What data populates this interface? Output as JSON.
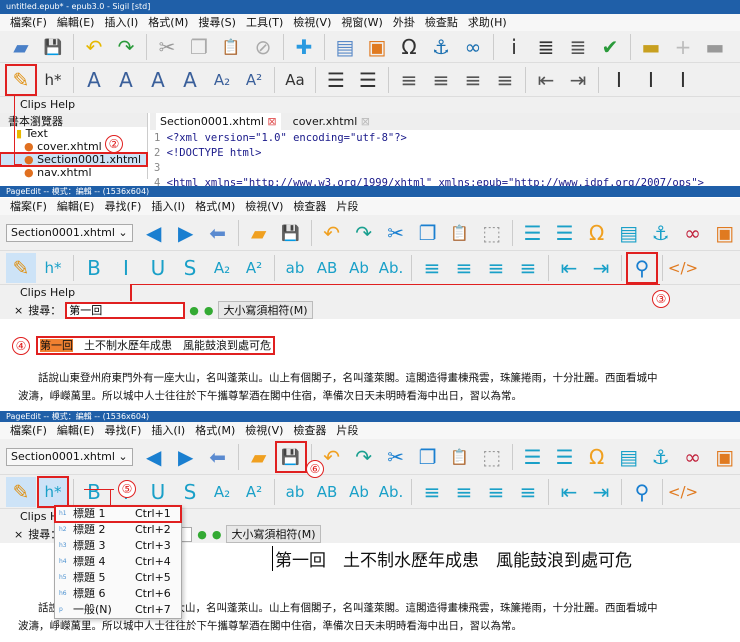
{
  "sigil": {
    "title": "untitled.epub* - epub3.0 - Sigil [std]",
    "menu": [
      "檔案(F)",
      "編輯(E)",
      "插入(I)",
      "格式(M)",
      "搜尋(S)",
      "工具(T)",
      "檢視(V)",
      "視窗(W)",
      "外掛",
      "檢查點",
      "求助(H)"
    ],
    "toolbar1": [
      "open-icon",
      "save-icon",
      "undo-icon",
      "redo-icon",
      "cut-icon",
      "copy-icon",
      "paste-icon",
      "stop-icon",
      "add-icon",
      "split-icon",
      "image-icon",
      "omega-icon",
      "anchor-icon",
      "link-icon",
      "info-icon",
      "toc-icon",
      "toc-edit-icon",
      "spellcheck-icon",
      "marker-icon",
      "add-row-icon",
      "remove-icon"
    ],
    "toolbar2": [
      "pencil-icon",
      "heading-icon",
      "bold-icon",
      "italic-icon",
      "underline-icon",
      "strike-icon",
      "subscript-icon",
      "superscript-icon",
      "case-icon",
      "bullet-list-icon",
      "number-list-icon",
      "align-left-icon",
      "align-center-icon",
      "align-right-icon",
      "justify-icon",
      "outdent-icon",
      "indent-icon",
      "cursor-right-icon",
      "cursor-left-icon",
      "cursor-split-icon"
    ],
    "clips_help": "Clips Help",
    "browser": {
      "title": "書本瀏覽器",
      "folder": "Text",
      "files": [
        "cover.xhtml",
        "Section0001.xhtml",
        "nav.xhtml"
      ]
    },
    "tabs": [
      "Section0001.xhtml",
      "cover.xhtml"
    ],
    "code": [
      {
        "n": "1",
        "t": "<?xml version=\"1.0\" encoding=\"utf-8\"?>"
      },
      {
        "n": "2",
        "t": "<!DOCTYPE html>"
      },
      {
        "n": "3",
        "t": ""
      },
      {
        "n": "4",
        "t": "<html xmlns=\"http://www.w3.org/1999/xhtml\" xmlns:epub=\"http://www.idpf.org/2007/ops\">"
      }
    ]
  },
  "pageedit": {
    "title": "PageEdit -- 模式：編輯 -- (1536x604)",
    "menu": [
      "檔案(F)",
      "編輯(E)",
      "尋找(F)",
      "插入(I)",
      "格式(M)",
      "檢視(V)",
      "檢查器",
      "片段"
    ],
    "file_select": "Section0001.xhtml",
    "toolbar1": [
      "back-icon",
      "forward-icon",
      "return-icon",
      "folder-icon",
      "save-icon",
      "undo-icon",
      "redo-icon",
      "cut-icon",
      "copy-icon",
      "paste-icon",
      "select-all-icon",
      "bullet-list-icon",
      "number-list-icon",
      "omega-icon",
      "insert-icon",
      "anchor-icon",
      "link-icon",
      "image-icon"
    ],
    "toolbar2": [
      "pencil-icon",
      "heading-icon",
      "bold-icon",
      "italic-icon",
      "underline-icon",
      "strike-icon",
      "subscript-icon",
      "superscript-icon",
      "lowercase-icon",
      "uppercase-icon",
      "titlecase-icon",
      "sentencecase-icon",
      "align-left-icon",
      "align-center-icon",
      "align-right-icon",
      "justify-icon",
      "outdent-icon",
      "indent-icon",
      "search-icon",
      "code-icon"
    ],
    "clips_help": "Clips Help",
    "search_label": "搜尋：",
    "search_value": "第一回",
    "match_case": "大小寫須相符(M)",
    "heading": {
      "num": "第一回",
      "rest": "　土不制水歷年成患　風能鼓浪到處可危"
    },
    "heading_full": "第一回　土不制水歷年成患　風能鼓浪到處可危",
    "para1": "話說山東登州府東門外有一座大山，名叫蓬萊山。山上有個閣子，名叫蓬萊閣。這閣造得畫棟飛雲，珠簾捲雨，十分壯麗。西面看城中",
    "para2": "波濤，崢嶸萬里。所以城中人士往往於下午攜尊挈酒在閣中住宿，準備次日天未明時看海中出日，習以為常。",
    "para1b": "話說山東登州府東門外有一座大山，名叫蓬萊山。山上有個閣子，名叫蓬萊閣。這閣造得畫棟飛雲，珠簾捲雨，十分壯麗。西面看城中",
    "heading_menu": [
      {
        "tag": "h1",
        "label": "標題 1",
        "key": "Ctrl+1"
      },
      {
        "tag": "h2",
        "label": "標題 2",
        "key": "Ctrl+2"
      },
      {
        "tag": "h3",
        "label": "標題 3",
        "key": "Ctrl+3"
      },
      {
        "tag": "h4",
        "label": "標題 4",
        "key": "Ctrl+4"
      },
      {
        "tag": "h5",
        "label": "標題 5",
        "key": "Ctrl+5"
      },
      {
        "tag": "h6",
        "label": "標題 6",
        "key": "Ctrl+6"
      },
      {
        "tag": "p",
        "label": "一般(N)",
        "key": "Ctrl+7"
      }
    ]
  },
  "steps": [
    "②",
    "③",
    "④",
    "⑤",
    "⑥"
  ],
  "colors": {
    "accent": "#e02020",
    "titlebar": "#1f5fa8",
    "blue_icon": "#1a7fd0",
    "teal_icon": "#1aa0c8"
  }
}
